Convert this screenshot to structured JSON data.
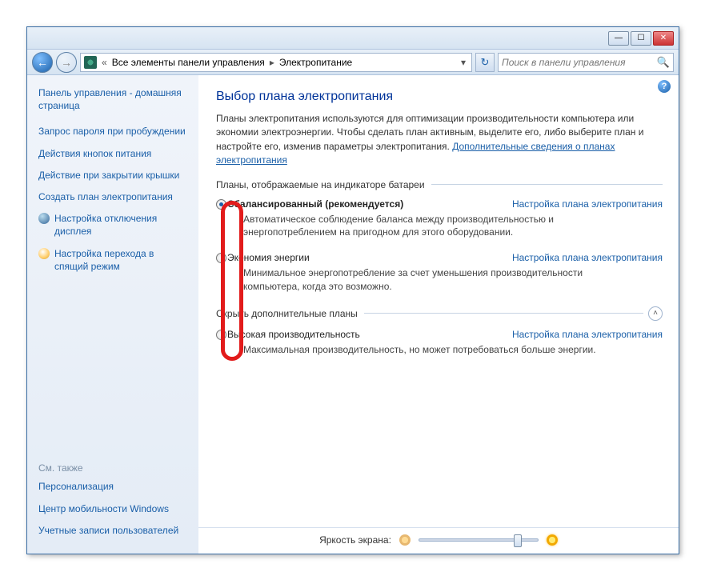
{
  "breadcrumb": {
    "level1": "Все элементы панели управления",
    "level2": "Электропитание"
  },
  "search": {
    "placeholder": "Поиск в панели управления"
  },
  "sidebar": {
    "home": "Панель управления - домашняя страница",
    "links": [
      "Запрос пароля при пробуждении",
      "Действия кнопок питания",
      "Действие при закрытии крышки",
      "Создать план электропитания",
      "Настройка отключения дисплея",
      "Настройка перехода в спящий режим"
    ],
    "see_also_heading": "См. также",
    "see_also": [
      "Персонализация",
      "Центр мобильности Windows",
      "Учетные записи пользователей"
    ]
  },
  "main": {
    "heading": "Выбор плана электропитания",
    "intro_pre": "Планы электропитания используются для оптимизации производительности компьютера или экономии электроэнергии. Чтобы сделать план активным, выделите его, либо выберите план и настройте его, изменив параметры электропитания. ",
    "intro_link": "Дополнительные сведения о планах электропитания",
    "group1_title": "Планы, отображаемые на индикаторе батареи",
    "group2_title": "Скрыть дополнительные планы",
    "plans": [
      {
        "name": "Сбалансированный (рекомендуется)",
        "desc": "Автоматическое соблюдение баланса между производительностью и энергопотреблением на пригодном для этого оборудовании.",
        "link": "Настройка плана электропитания",
        "checked": true
      },
      {
        "name": "Экономия энергии",
        "desc": "Минимальное энергопотребление за счет уменьшения производительности компьютера, когда это возможно.",
        "link": "Настройка плана электропитания",
        "checked": false
      },
      {
        "name": "Высокая производительность",
        "desc": "Максимальная производительность, но может потребоваться больше энергии.",
        "link": "Настройка плана электропитания",
        "checked": false
      }
    ],
    "brightness_label": "Яркость экрана:"
  }
}
